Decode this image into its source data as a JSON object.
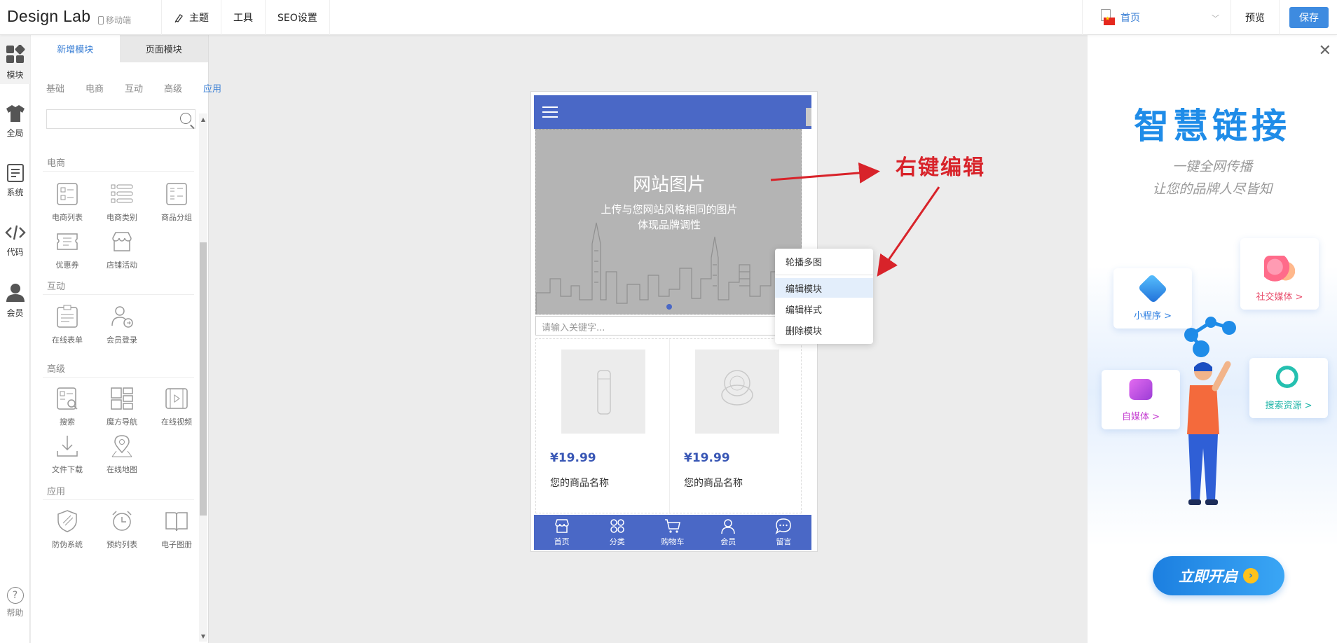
{
  "topbar": {
    "brand": "Design Lab",
    "mobile_label": "移动端",
    "nav": [
      {
        "label": "主题"
      },
      {
        "label": "工具"
      },
      {
        "label": "SEO设置"
      }
    ],
    "page_select": "首页",
    "preview": "预览",
    "save": "保存",
    "accent": "#3e8be0"
  },
  "iconbar": {
    "items": [
      {
        "label": "模块",
        "icon": "grid-icon"
      },
      {
        "label": "全局",
        "icon": "shirt-icon"
      },
      {
        "label": "系统",
        "icon": "document-icon"
      },
      {
        "label": "代码",
        "icon": "code-icon"
      },
      {
        "label": "会员",
        "icon": "user-icon"
      }
    ],
    "help": "帮助"
  },
  "panel": {
    "tabs": [
      "新增模块",
      "页面模块"
    ],
    "categories": [
      "基础",
      "电商",
      "互动",
      "高级",
      "应用"
    ],
    "active_category": "应用",
    "search_placeholder": "",
    "sections": [
      {
        "title": "电商",
        "modules": [
          "电商列表",
          "电商类别",
          "商品分组",
          "优惠券",
          "店铺活动"
        ]
      },
      {
        "title": "互动",
        "modules": [
          "在线表单",
          "会员登录"
        ]
      },
      {
        "title": "高级",
        "modules": [
          "搜索",
          "魔方导航",
          "在线视频",
          "文件下载",
          "在线地图"
        ]
      },
      {
        "title": "应用",
        "modules": [
          "防伪系统",
          "预约列表",
          "电子图册"
        ]
      }
    ]
  },
  "phone": {
    "banner_title": "网站图片",
    "banner_line1": "上传与您网站风格相同的图片",
    "banner_line2": "体现品牌调性",
    "keyword_placeholder": "请输入关键字...",
    "products": [
      {
        "price": "¥19.99",
        "name": "您的商品名称"
      },
      {
        "price": "¥19.99",
        "name": "您的商品名称"
      }
    ],
    "footer": [
      {
        "label": "首页",
        "icon": "store-icon"
      },
      {
        "label": "分类",
        "icon": "category-icon"
      },
      {
        "label": "购物车",
        "icon": "cart-icon"
      },
      {
        "label": "会员",
        "icon": "member-icon"
      },
      {
        "label": "留言",
        "icon": "message-icon"
      }
    ],
    "theme_color": "#4a68c6"
  },
  "context_menu": {
    "items": [
      "轮播多图",
      "编辑模块",
      "编辑样式",
      "删除模块"
    ],
    "highlighted": "编辑模块"
  },
  "annotation": "右键编辑",
  "ad": {
    "title": "智慧链接",
    "subtitle_1": "一键全网传播",
    "subtitle_2": "让您的品牌人尽皆知",
    "cards": [
      {
        "label": "社交媒体 >",
        "color": "#e84b6a"
      },
      {
        "label": "小程序 >",
        "color": "#2d7ee0"
      },
      {
        "label": "自媒体 >",
        "color": "#c43ad0"
      },
      {
        "label": "搜索资源 >",
        "color": "#1fb5a8"
      }
    ],
    "cta": "立即开启"
  }
}
